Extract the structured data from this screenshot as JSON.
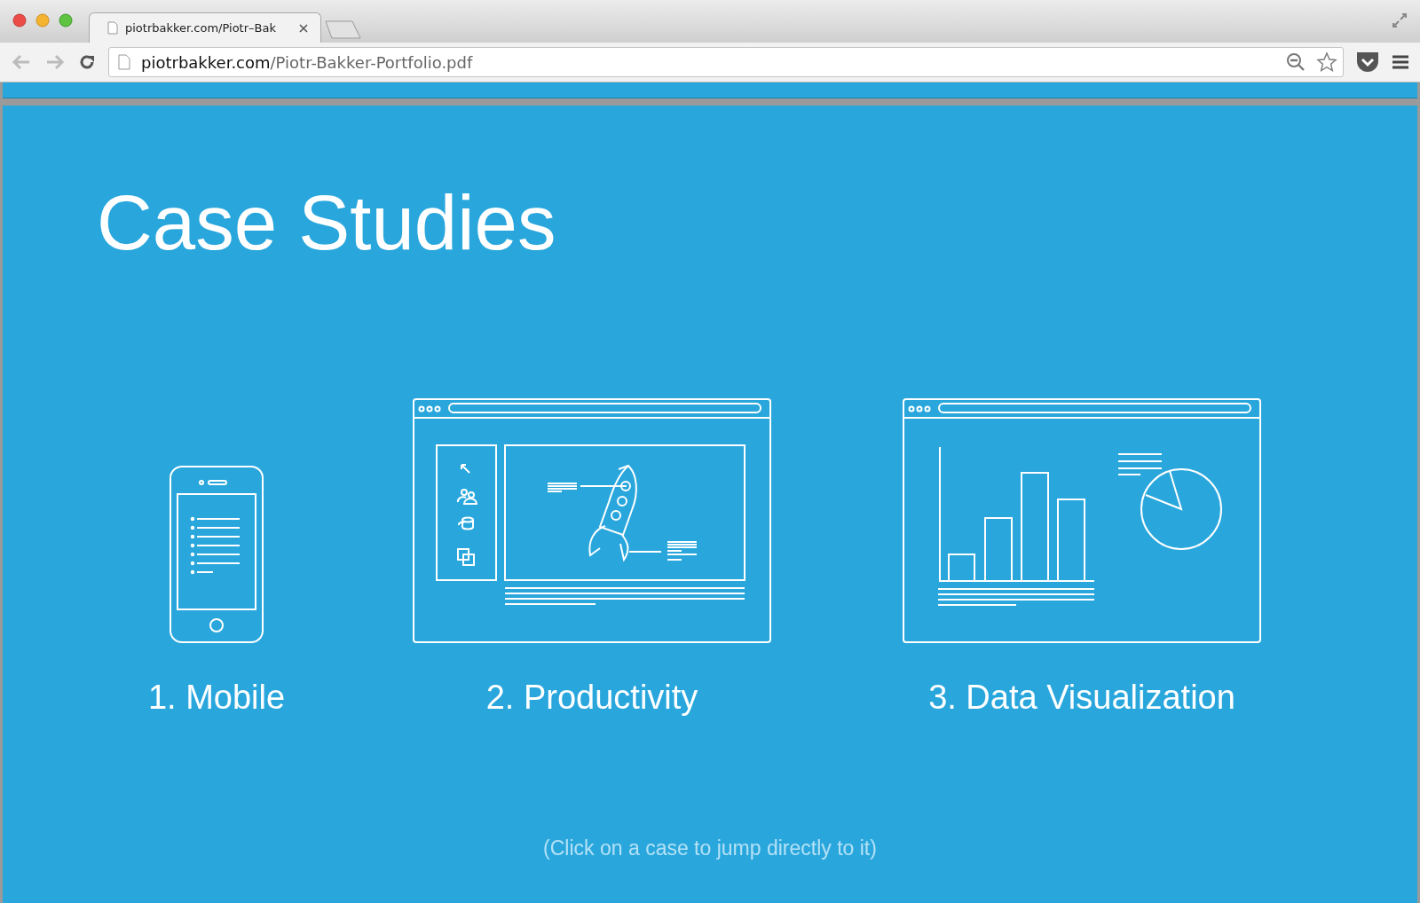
{
  "browser": {
    "tabs": [
      {
        "title": "piotrbakker.com/Piotr–Bak",
        "selected": true
      }
    ],
    "url": {
      "host": "piotrbakker.com",
      "path": "/Piotr-Bakker-Portfolio.pdf"
    }
  },
  "page": {
    "heading": "Case Studies",
    "cases": [
      {
        "kind": "mobile",
        "label": "1. Mobile"
      },
      {
        "kind": "productivity",
        "label": "2. Productivity"
      },
      {
        "kind": "data",
        "label": "3. Data Visualization"
      }
    ],
    "hint": "(Click on a case to jump directly to it)"
  }
}
